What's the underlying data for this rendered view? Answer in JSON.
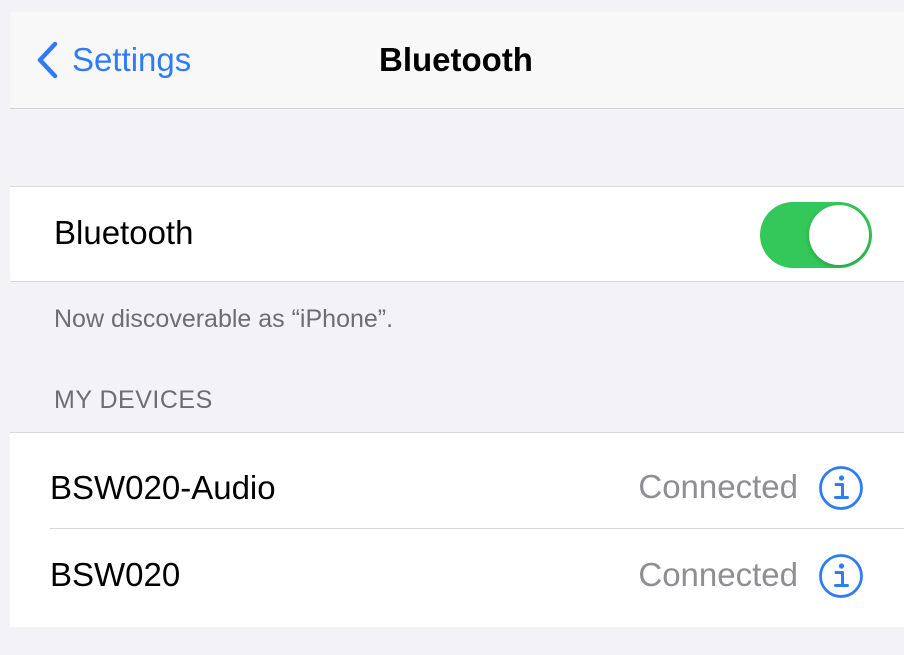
{
  "navbar": {
    "back_label": "Settings",
    "title": "Bluetooth"
  },
  "bluetooth_toggle": {
    "label": "Bluetooth",
    "on": true
  },
  "discoverable_note": "Now discoverable as “iPhone”.",
  "my_devices": {
    "header": "MY DEVICES",
    "items": [
      {
        "name": "BSW020-Audio",
        "status": "Connected",
        "icon": "info-icon"
      },
      {
        "name": "BSW020",
        "status": "Connected",
        "icon": "info-icon"
      }
    ]
  },
  "colors": {
    "accent": "#2f7cf6",
    "switch_on": "#34c759",
    "background": "#f2f2f7",
    "secondary_text": "#8e8e93"
  }
}
